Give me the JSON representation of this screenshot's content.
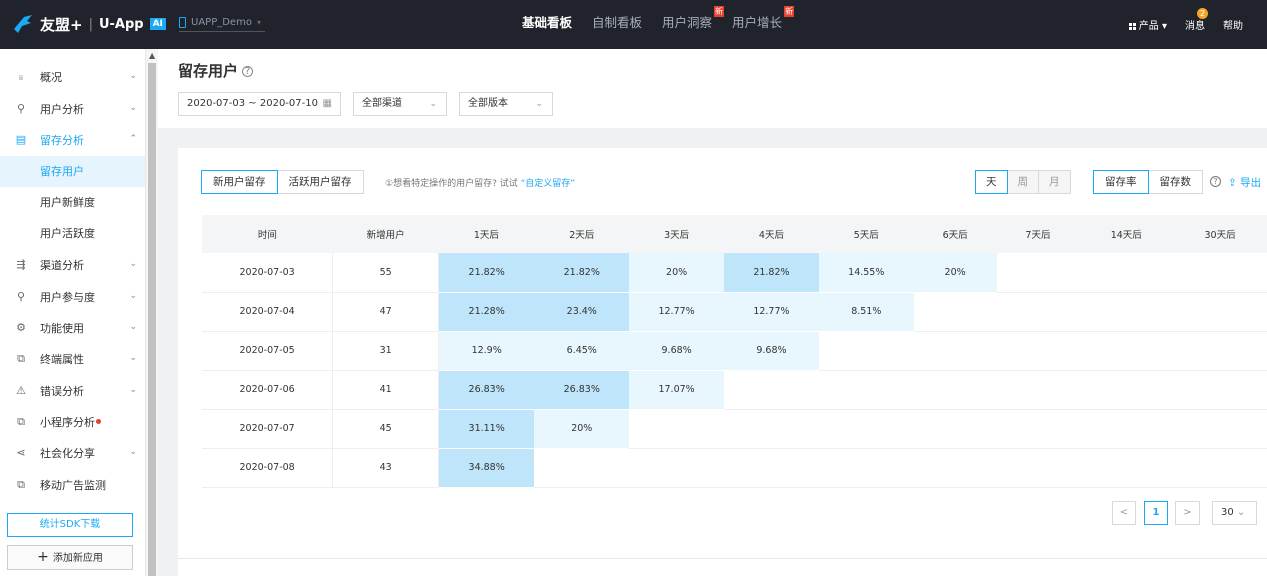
{
  "header": {
    "brand": "友盟+",
    "sep": "|",
    "product": "U-App",
    "ai_tag": "AI",
    "app_name": "UAPP_Demo",
    "nav": [
      {
        "label": "基础看板",
        "active": true,
        "new": ""
      },
      {
        "label": "自制看板",
        "active": false,
        "new": ""
      },
      {
        "label": "用户洞察",
        "active": false,
        "new": "新"
      },
      {
        "label": "用户增长",
        "active": false,
        "new": "新"
      }
    ],
    "products_label": "产品",
    "message_label": "消息",
    "message_count": "2",
    "help_label": "帮助"
  },
  "sidebar": {
    "items": [
      {
        "label": "概况",
        "icon": "overview-icon",
        "glyph": "ᵢᵢ",
        "chevron": "⌄"
      },
      {
        "label": "用户分析",
        "icon": "user-analysis-icon",
        "glyph": "⚲",
        "chevron": "⌄"
      },
      {
        "label": "留存分析",
        "icon": "retention-icon",
        "glyph": "▤",
        "chevron": "⌃"
      },
      {
        "label": "渠道分析",
        "icon": "channel-icon",
        "glyph": "⇶",
        "chevron": "⌄"
      },
      {
        "label": "用户参与度",
        "icon": "engagement-icon",
        "glyph": "⚲",
        "chevron": "⌄"
      },
      {
        "label": "功能使用",
        "icon": "feature-icon",
        "glyph": "⚙",
        "chevron": "⌄"
      },
      {
        "label": "终端属性",
        "icon": "device-icon",
        "glyph": "⧉",
        "chevron": "⌄"
      },
      {
        "label": "错误分析",
        "icon": "error-icon",
        "glyph": "⚠",
        "chevron": "⌄"
      },
      {
        "label": "小程序分析",
        "icon": "miniapp-icon",
        "glyph": "⧉",
        "chevron": ""
      },
      {
        "label": "社会化分享",
        "icon": "share-icon",
        "glyph": "⋖",
        "chevron": "⌄"
      },
      {
        "label": "移动广告监测",
        "icon": "ad-icon",
        "glyph": "⧉",
        "chevron": ""
      }
    ],
    "subitems": [
      "留存用户",
      "用户新鲜度",
      "用户活跃度"
    ],
    "sdk_button": "统计SDK下载",
    "add_button": "添加新应用",
    "add_plus": "+"
  },
  "page": {
    "title": "留存用户",
    "help": "?",
    "date_range": "2020-07-03 ~ 2020-07-10",
    "channel": "全部渠道",
    "version": "全部版本"
  },
  "toolbar": {
    "tabs": [
      "新用户留存",
      "活跃用户留存"
    ],
    "hint": "①想看特定操作的用户留存? 试试",
    "hint_link": "“自定义留存”",
    "periods": [
      "天",
      "周",
      "月"
    ],
    "modes": [
      "留存率",
      "留存数"
    ],
    "export": "导出"
  },
  "table": {
    "headers": [
      "时间",
      "新增用户",
      "1天后",
      "2天后",
      "3天后",
      "4天后",
      "5天后",
      "6天后",
      "7天后",
      "14天后",
      "30天后"
    ],
    "rows": [
      {
        "date": "2020-07-03",
        "new_users": "55",
        "values": [
          "21.82%",
          "21.82%",
          "20%",
          "21.82%",
          "14.55%",
          "20%",
          "",
          "",
          ""
        ]
      },
      {
        "date": "2020-07-04",
        "new_users": "47",
        "values": [
          "21.28%",
          "23.4%",
          "12.77%",
          "12.77%",
          "8.51%",
          "",
          "",
          "",
          ""
        ]
      },
      {
        "date": "2020-07-05",
        "new_users": "31",
        "values": [
          "12.9%",
          "6.45%",
          "9.68%",
          "9.68%",
          "",
          "",
          "",
          "",
          ""
        ]
      },
      {
        "date": "2020-07-06",
        "new_users": "41",
        "values": [
          "26.83%",
          "26.83%",
          "17.07%",
          "",
          "",
          "",
          "",
          "",
          ""
        ]
      },
      {
        "date": "2020-07-07",
        "new_users": "45",
        "values": [
          "31.11%",
          "20%",
          "",
          "",
          "",
          "",
          "",
          "",
          ""
        ]
      },
      {
        "date": "2020-07-08",
        "new_users": "43",
        "values": [
          "34.88%",
          "",
          "",
          "",
          "",
          "",
          "",
          "",
          ""
        ]
      }
    ]
  },
  "pagination": {
    "prev": "<",
    "page": "1",
    "next": ">",
    "page_size": "30"
  },
  "colors": {
    "accent": "#1ba8f5",
    "heat_high": "#bfe5fb",
    "heat_low": "#e8f6fd",
    "topbar": "#20232b"
  }
}
